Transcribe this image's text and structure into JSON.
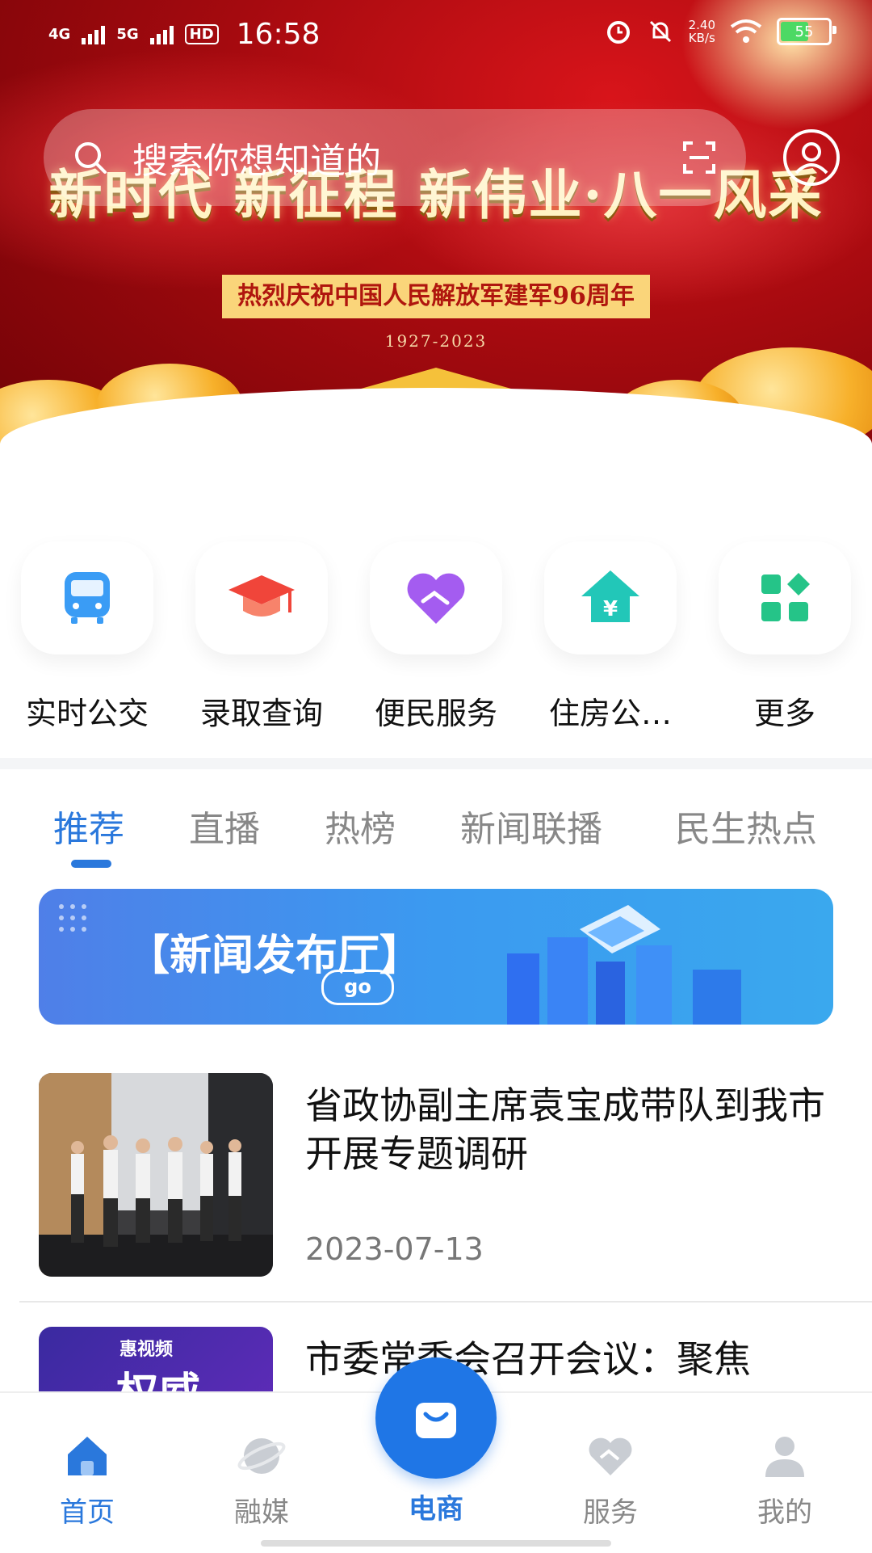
{
  "status_bar": {
    "net1": "4G",
    "net2": "5G",
    "hd": "HD",
    "time": "16:58",
    "speed_value": "2.40",
    "speed_unit": "KB/s",
    "battery": "55"
  },
  "search": {
    "placeholder": "搜索你想知道的"
  },
  "hero": {
    "slogan": "新时代 新征程 新伟业·八一风采",
    "subtitle": "热烈庆祝中国人民解放军建军96周年",
    "years": "1927-2023"
  },
  "quick_links": [
    {
      "label": "实时公交",
      "icon": "bus-icon"
    },
    {
      "label": "录取查询",
      "icon": "graduation-cap-icon"
    },
    {
      "label": "便民服务",
      "icon": "handshake-heart-icon"
    },
    {
      "label": "住房公…",
      "icon": "house-yuan-icon"
    },
    {
      "label": "更多",
      "icon": "grid-more-icon"
    }
  ],
  "tabs": [
    {
      "label": "推荐",
      "active": true
    },
    {
      "label": "直播",
      "active": false
    },
    {
      "label": "热榜",
      "active": false
    },
    {
      "label": "新闻联播",
      "active": false
    },
    {
      "label": "民生热点",
      "active": false
    }
  ],
  "press_banner": {
    "title": "【新闻发布厅】",
    "go": "go"
  },
  "news": [
    {
      "title": "省政协副主席袁宝成带队到我市开展专题调研",
      "date": "2023-07-13"
    },
    {
      "title": "市委常委会召开会议：聚焦",
      "thumb_tag": "惠视频",
      "thumb_text": "权威"
    }
  ],
  "bottom_nav": [
    {
      "label": "首页",
      "icon": "home-icon",
      "active": true
    },
    {
      "label": "融媒",
      "icon": "planet-icon",
      "active": false
    },
    {
      "label": "电商",
      "icon": "shopping-bag-icon",
      "active": false
    },
    {
      "label": "服务",
      "icon": "service-heart-icon",
      "active": false
    },
    {
      "label": "我的",
      "icon": "user-icon",
      "active": false
    }
  ],
  "colors": {
    "accent": "#2a78dc",
    "hero_red": "#b10c12",
    "gold": "#fad57a"
  }
}
